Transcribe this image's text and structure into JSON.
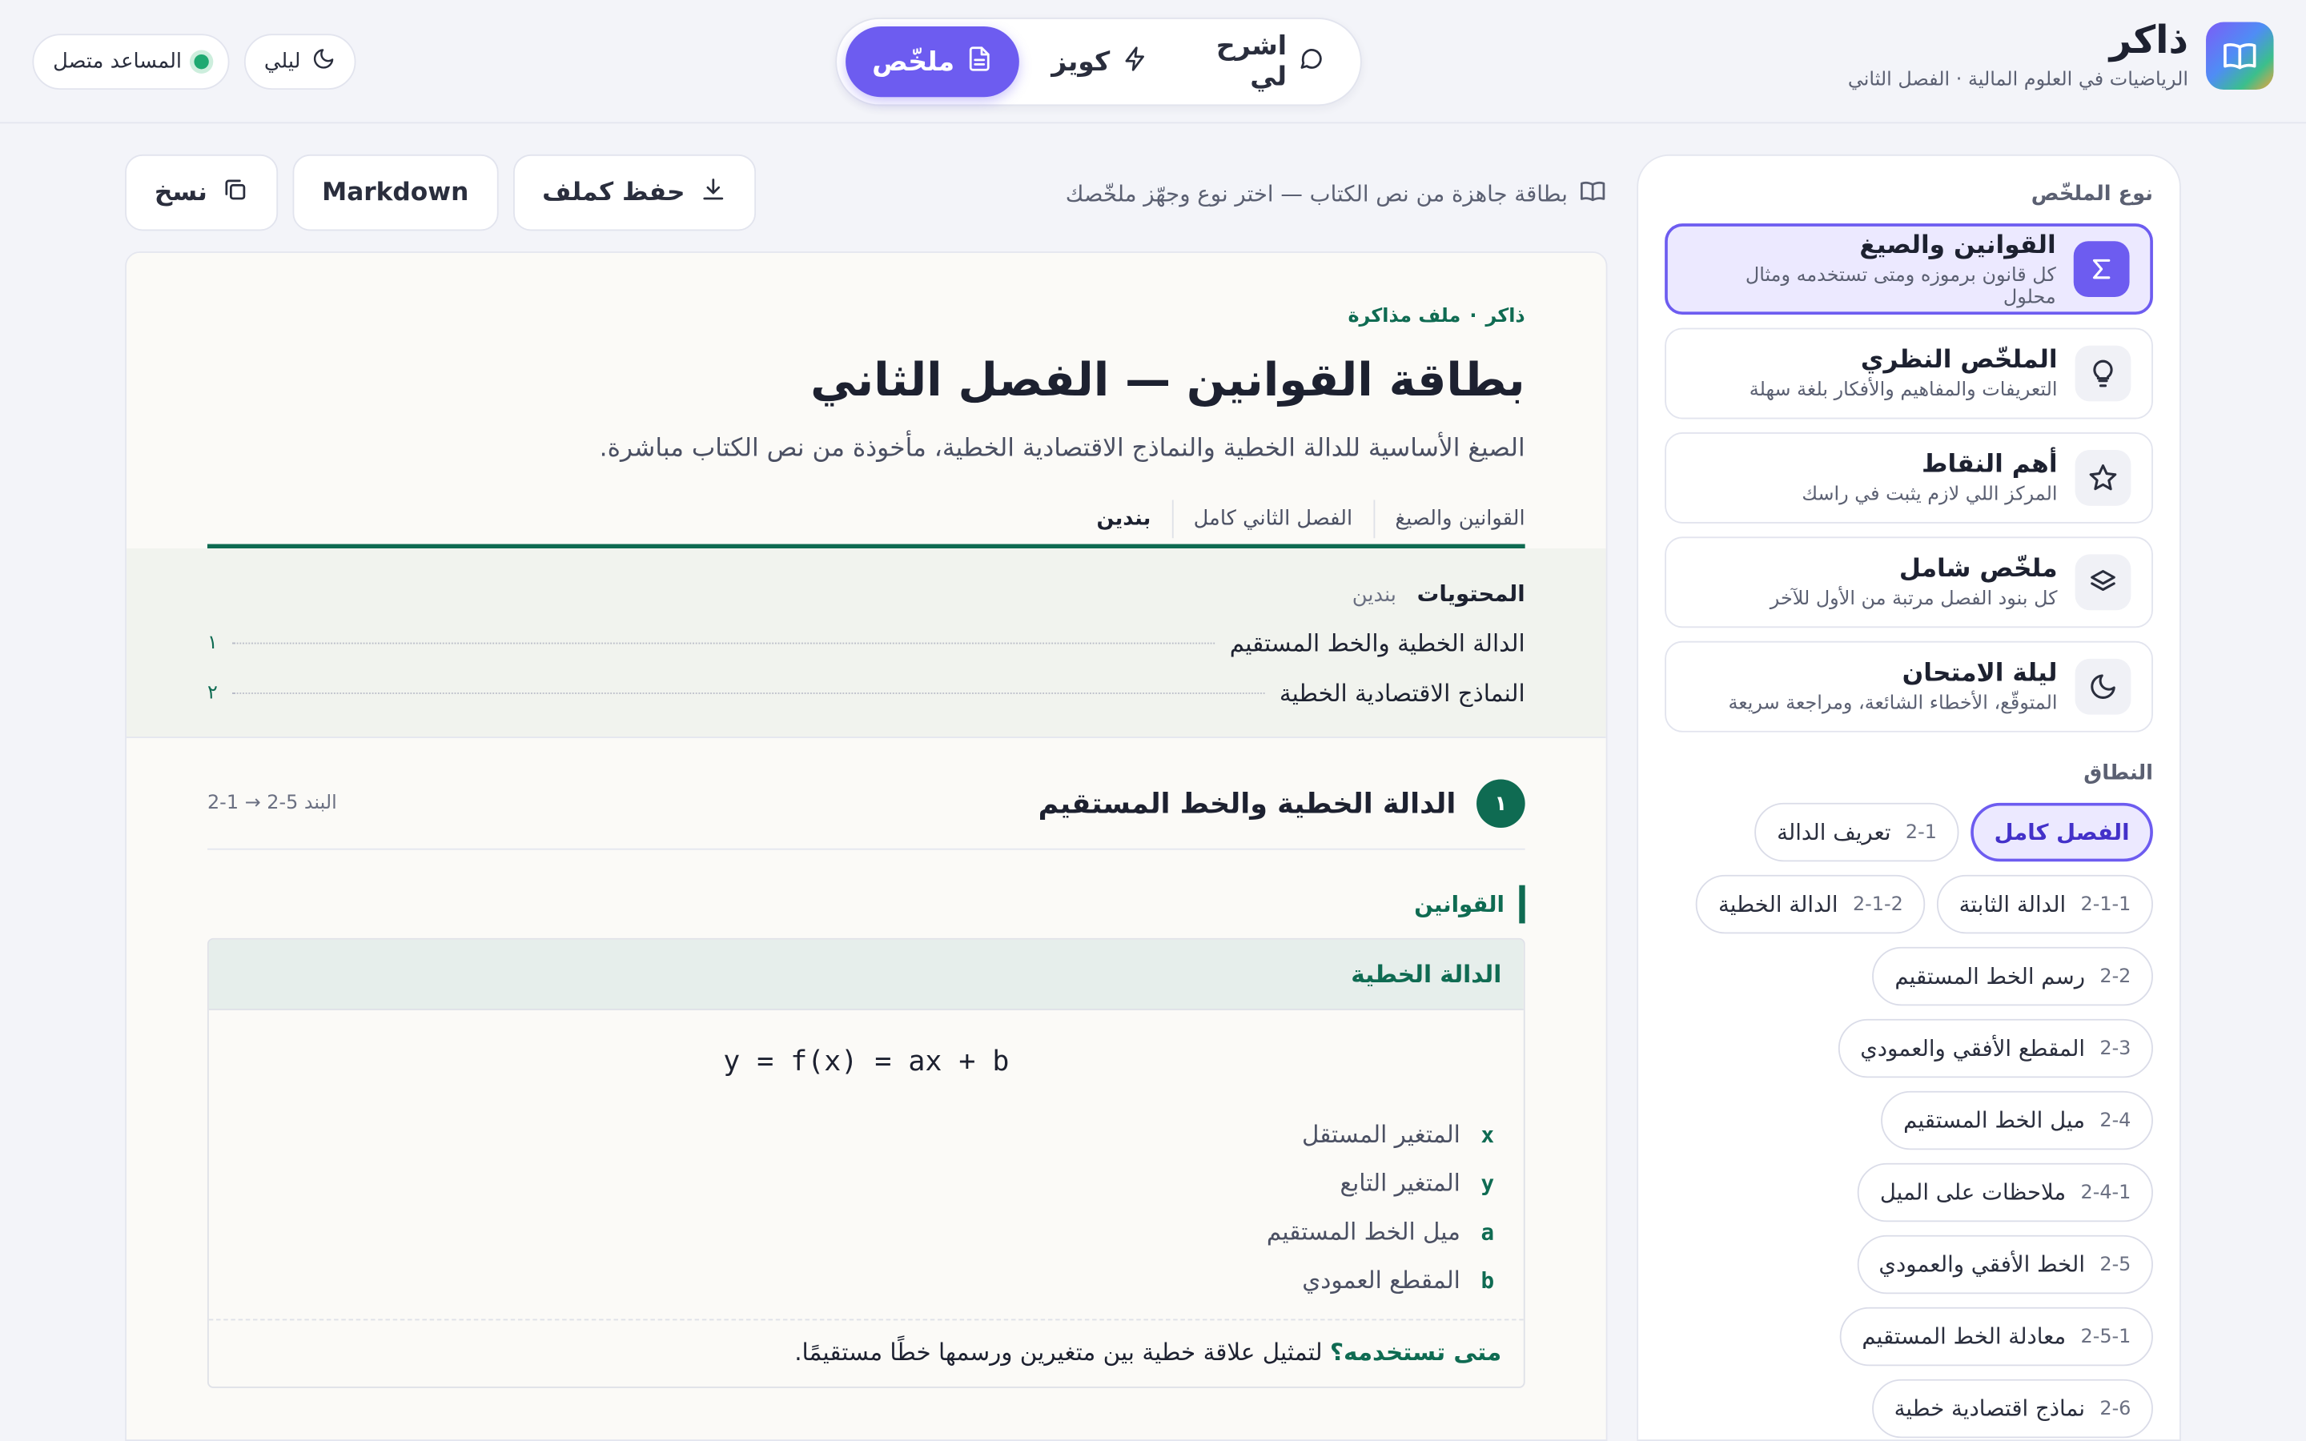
{
  "app": {
    "name": "ذاكر",
    "subtitle": "الرياضيات في العلوم المالية · الفصل الثاني"
  },
  "modes": [
    {
      "label": "اشرح لي",
      "icon": "chat-bubble-icon"
    },
    {
      "label": "كويز",
      "icon": "lightning-icon"
    },
    {
      "label": "ملخّص",
      "icon": "document-icon",
      "active": true
    }
  ],
  "header_left": {
    "theme_label": "ليلي",
    "assistant_label": "المساعد متصل"
  },
  "sidebar": {
    "type_title": "نوع الملخّص",
    "types": [
      {
        "title": "القوانين والصيغ",
        "desc": "كل قانون برموزه ومتى تستخدمه ومثال محلول",
        "icon": "sigma-icon",
        "active": true
      },
      {
        "title": "الملخّص النظري",
        "desc": "التعريفات والمفاهيم والأفكار بلغة سهلة",
        "icon": "lightbulb-icon"
      },
      {
        "title": "أهم النقاط",
        "desc": "المركز اللي لازم يثبت في راسك",
        "icon": "star-icon"
      },
      {
        "title": "ملخّص شامل",
        "desc": "كل بنود الفصل مرتبة من الأول للآخر",
        "icon": "layers-icon"
      },
      {
        "title": "ليلة الامتحان",
        "desc": "المتوقّع، الأخطاء الشائعة، ومراجعة سريعة",
        "icon": "moon-icon"
      }
    ],
    "scope_title": "النطاق",
    "chips": [
      {
        "num": "",
        "label": "الفصل كامل",
        "active": true
      },
      {
        "num": "2-1",
        "label": "تعريف الدالة"
      },
      {
        "num": "2-1-1",
        "label": "الدالة الثابتة"
      },
      {
        "num": "2-1-2",
        "label": "الدالة الخطية"
      },
      {
        "num": "2-2",
        "label": "رسم الخط المستقيم"
      },
      {
        "num": "2-3",
        "label": "المقطع الأفقي والعمودي"
      },
      {
        "num": "2-4",
        "label": "ميل الخط المستقيم"
      },
      {
        "num": "2-4-1",
        "label": "ملاحظات على الميل"
      },
      {
        "num": "2-5",
        "label": "الخط الأفقي والعمودي"
      },
      {
        "num": "2-5-1",
        "label": "معادلة الخط المستقيم"
      },
      {
        "num": "2-6",
        "label": "نماذج اقتصادية خطية"
      }
    ]
  },
  "toolbar": {
    "note": "بطاقة جاهزة من نص الكتاب — اختر نوع وجهّز ملخّصك",
    "save_label": "حفظ كملف",
    "markdown_label": "Markdown",
    "copy_label": "نسخ"
  },
  "document": {
    "eyebrow_brand": "ذاكر",
    "eyebrow_sep": "·",
    "eyebrow_kind": "ملف مذاكرة",
    "title": "بطاقة القوانين — الفصل الثاني",
    "subtitle": "الصيغ الأساسية للدالة الخطية والنماذج الاقتصادية الخطية، مأخوذة من نص الكتاب مباشرة.",
    "tabs": [
      "القوانين والصيغ",
      "الفصل الثاني كامل",
      "بندين"
    ],
    "toc": {
      "title": "المحتويات",
      "count": "بندين",
      "items": [
        {
          "label": "الدالة الخطية والخط المستقيم",
          "page": "١"
        },
        {
          "label": "النماذج الاقتصادية الخطية",
          "page": "٢"
        }
      ]
    },
    "section": {
      "num": "١",
      "title": "الدالة الخطية والخط المستقيم",
      "range": "البند 5-2 → 1-2"
    },
    "laws_label": "القوانين",
    "law": {
      "title": "الدالة الخطية",
      "formula": "y = f(x) = ax + b",
      "vars": [
        {
          "sym": "x",
          "desc": "المتغير المستقل"
        },
        {
          "sym": "y",
          "desc": "المتغير التابع"
        },
        {
          "sym": "a",
          "desc": "ميل الخط المستقيم"
        },
        {
          "sym": "b",
          "desc": "المقطع العمودي"
        }
      ],
      "when_label": "متى تستخدمه؟",
      "when_text": "لتمثيل علاقة خطية بين متغيرين ورسمها خطًا مستقيمًا."
    }
  },
  "colors": {
    "accent": "#6d5cf0",
    "green": "#0f6b52",
    "background": "#f3f4f9"
  }
}
